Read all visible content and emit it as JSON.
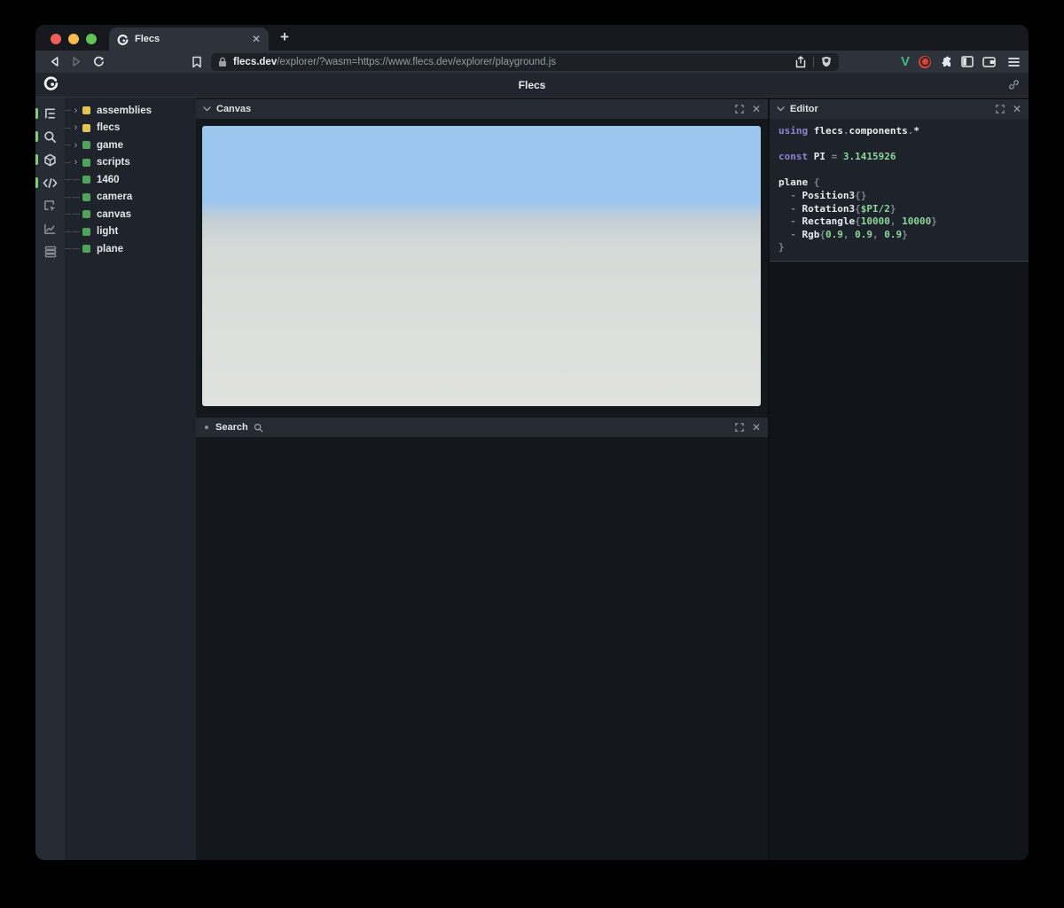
{
  "browser": {
    "tab": {
      "title": "Flecs",
      "close_label": "✕"
    },
    "new_tab_label": "+",
    "url": {
      "domain": "flecs.dev",
      "rest": "/explorer/?wasm=https://www.flecs.dev/explorer/playground.js"
    }
  },
  "app_header": {
    "title": "Flecs"
  },
  "rail": {
    "items": [
      {
        "icon": "entity-tree",
        "active": true
      },
      {
        "icon": "search",
        "active": true
      },
      {
        "icon": "entities",
        "active": true
      },
      {
        "icon": "code",
        "active": true
      },
      {
        "icon": "inspect",
        "active": false
      },
      {
        "icon": "stats",
        "active": false
      },
      {
        "icon": "rows",
        "active": false
      }
    ]
  },
  "tree": {
    "items": [
      {
        "label": "assemblies",
        "color": "yellow",
        "expandable": true
      },
      {
        "label": "flecs",
        "color": "yellow",
        "expandable": true
      },
      {
        "label": "game",
        "color": "green",
        "expandable": true
      },
      {
        "label": "scripts",
        "color": "green",
        "expandable": true
      },
      {
        "label": "1460",
        "color": "green",
        "expandable": false
      },
      {
        "label": "camera",
        "color": "green",
        "expandable": false
      },
      {
        "label": "canvas",
        "color": "green",
        "expandable": false
      },
      {
        "label": "light",
        "color": "green",
        "expandable": false
      },
      {
        "label": "plane",
        "color": "green",
        "expandable": false
      }
    ]
  },
  "canvas_panel": {
    "title": "Canvas"
  },
  "search_panel": {
    "title": "Search"
  },
  "editor": {
    "title": "Editor",
    "code": [
      [
        {
          "t": "using ",
          "c": "kw"
        },
        {
          "t": "flecs",
          "c": "id"
        },
        {
          "t": ".",
          "c": "p"
        },
        {
          "t": "components",
          "c": "id"
        },
        {
          "t": ".",
          "c": "p"
        },
        {
          "t": "*",
          "c": "id"
        }
      ],
      [],
      [
        {
          "t": "const ",
          "c": "kw"
        },
        {
          "t": "PI ",
          "c": "id"
        },
        {
          "t": "= ",
          "c": "p"
        },
        {
          "t": "3.1415926",
          "c": "num"
        }
      ],
      [],
      [
        {
          "t": "plane ",
          "c": "id"
        },
        {
          "t": "{",
          "c": "p"
        }
      ],
      [
        {
          "t": "  - ",
          "c": "p"
        },
        {
          "t": "Position3",
          "c": "id"
        },
        {
          "t": "{}",
          "c": "p"
        }
      ],
      [
        {
          "t": "  - ",
          "c": "p"
        },
        {
          "t": "Rotation3",
          "c": "id"
        },
        {
          "t": "{",
          "c": "p"
        },
        {
          "t": "$PI/2",
          "c": "num"
        },
        {
          "t": "}",
          "c": "p"
        }
      ],
      [
        {
          "t": "  - ",
          "c": "p"
        },
        {
          "t": "Rectangle",
          "c": "id"
        },
        {
          "t": "{",
          "c": "p"
        },
        {
          "t": "10000",
          "c": "num"
        },
        {
          "t": ", ",
          "c": "p"
        },
        {
          "t": "10000",
          "c": "num"
        },
        {
          "t": "}",
          "c": "p"
        }
      ],
      [
        {
          "t": "  - ",
          "c": "p"
        },
        {
          "t": "Rgb",
          "c": "id"
        },
        {
          "t": "{",
          "c": "p"
        },
        {
          "t": "0.9",
          "c": "num"
        },
        {
          "t": ", ",
          "c": "p"
        },
        {
          "t": "0.9",
          "c": "num"
        },
        {
          "t": ", ",
          "c": "p"
        },
        {
          "t": "0.9",
          "c": "num"
        },
        {
          "t": "}",
          "c": "p"
        }
      ],
      [
        {
          "t": "}",
          "c": "p"
        }
      ]
    ]
  },
  "colors": {
    "module_yellow": "#e2c654",
    "entity_green": "#50a35c",
    "active_pill_green": "#7ecf7a",
    "sky_blue": "#9dc6ef",
    "ground_gray": "#dfe2df",
    "vue_green": "#42b883",
    "ext_red": "#d8453c"
  }
}
